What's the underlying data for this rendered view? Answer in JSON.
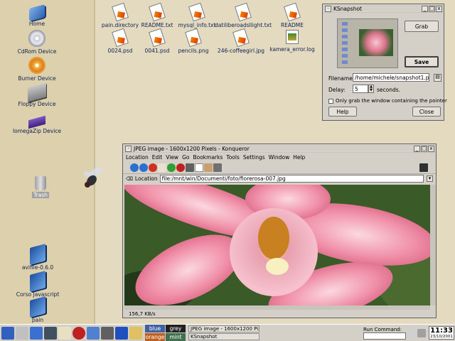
{
  "desktop_icons": [
    {
      "label": "Home",
      "icon": "home-icon"
    },
    {
      "label": "CdRom Device",
      "icon": "cdrom-icon"
    },
    {
      "label": "Burner Device",
      "icon": "burner-icon"
    },
    {
      "label": "Floppy Device",
      "icon": "floppy-icon"
    },
    {
      "label": "IomegaZip Device",
      "icon": "zip-drive-icon"
    },
    {
      "label": "Trash",
      "icon": "trash-icon"
    },
    {
      "label": "avifile-0.6.0",
      "icon": "folder-icon"
    },
    {
      "label": "Corso Javascript",
      "icon": "folder-icon"
    },
    {
      "label": "pain",
      "icon": "folder-icon"
    }
  ],
  "files_row1": [
    "pain.directory",
    "README.txt",
    "mysql_info.txt",
    "datiliberoadsllight.txt",
    "README"
  ],
  "files_row2": [
    "0024.psd",
    "0041.psd",
    "pencils.png",
    "246-coffeegirl.jpg",
    "kamera_error.log"
  ],
  "ksnapshot": {
    "title": "KSnapshot",
    "grab": "Grab",
    "save": "Save",
    "filename_label": "Filename:",
    "filename_value": "/home/michele/snapshot1.png",
    "delay_label": "Delay:",
    "delay_value": "5",
    "delay_unit": "seconds.",
    "only_grab_label": "Only grab the window containing the pointer",
    "help": "Help",
    "close": "Close"
  },
  "konqueror": {
    "title": "JPEG image - 1600x1200 Pixels - Konqueror",
    "menu": [
      "Location",
      "Edit",
      "View",
      "Go",
      "Bookmarks",
      "Tools",
      "Settings",
      "Window",
      "Help"
    ],
    "location_label": "Location",
    "url": "file:/mnt/win/Documenti/foto/fiorerosa-007.jpg",
    "status": "156,7 KB/s"
  },
  "taskbar": {
    "pager": [
      "blue",
      "grey",
      "orange",
      "mint"
    ],
    "tasks": [
      "JPEG image - 1600x1200 Pix",
      "KSnapshot"
    ],
    "run_label": "Run Command:",
    "clock": "11:33",
    "date": "23/10/2001"
  }
}
